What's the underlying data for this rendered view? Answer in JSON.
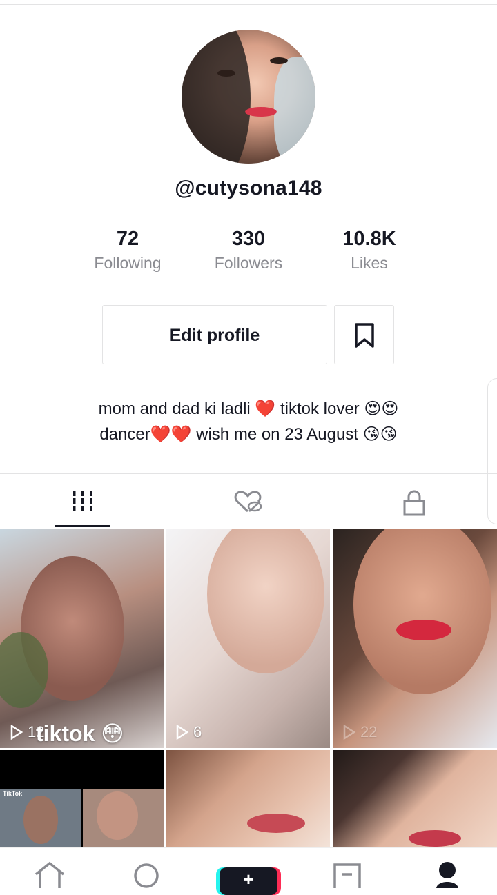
{
  "profile": {
    "username": "@cutysona148",
    "avatar_icon": "profile-photo"
  },
  "stats": [
    {
      "value": "72",
      "label": "Following"
    },
    {
      "value": "330",
      "label": "Followers"
    },
    {
      "value": "10.8K",
      "label": "Likes"
    }
  ],
  "actions": {
    "edit_profile": "Edit profile",
    "bookmark_icon": "bookmark-icon"
  },
  "bio": {
    "line1": "mom and dad ki ladli ❤️ tiktok lover 😍😍",
    "line2": "dancer❤️❤️  wish me on 23 August 😘😘"
  },
  "tabs": [
    {
      "icon": "grid-icon",
      "active": true
    },
    {
      "icon": "hidden-likes-icon",
      "active": false
    },
    {
      "icon": "lock-icon",
      "active": false
    }
  ],
  "videos": [
    {
      "views": "12",
      "overlay_text": "tiktok 😳"
    },
    {
      "views": "6",
      "overlay_text": ""
    },
    {
      "views": "22",
      "overlay_text": ""
    },
    {
      "views": "",
      "overlay_text": "TikTok"
    },
    {
      "views": "",
      "overlay_text": ""
    },
    {
      "views": "",
      "overlay_text": ""
    }
  ],
  "bottom_nav": [
    {
      "icon": "home-icon"
    },
    {
      "icon": "discover-icon"
    },
    {
      "icon": "create-plus-icon",
      "label": "+"
    },
    {
      "icon": "inbox-icon"
    },
    {
      "icon": "profile-icon"
    }
  ],
  "colors": {
    "text": "#161823",
    "muted": "#8a8b91",
    "border": "#e3e3e4",
    "accent_cyan": "#25f4ee",
    "accent_red": "#fe2c55"
  }
}
